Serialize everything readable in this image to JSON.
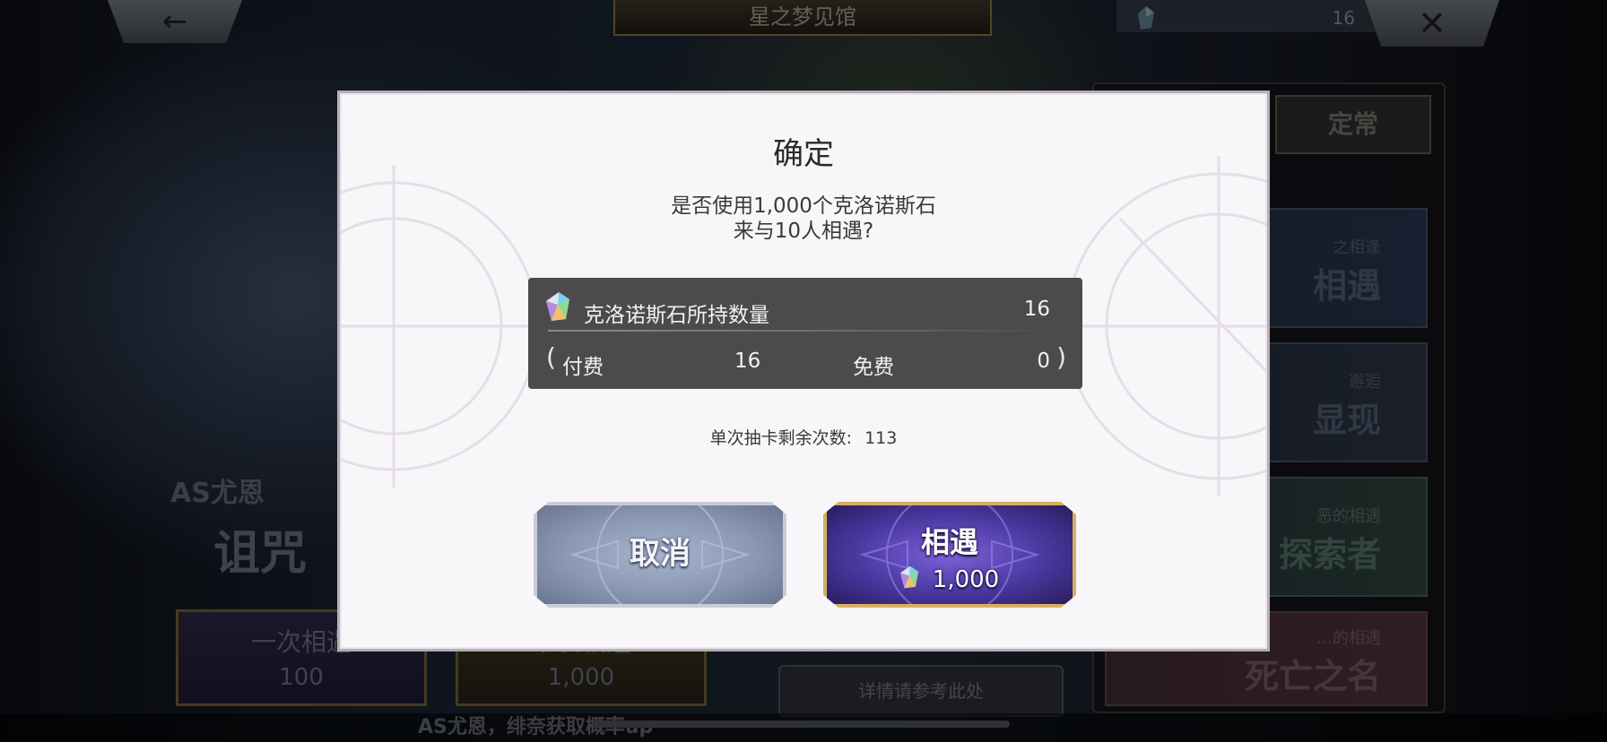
{
  "header": {
    "back_icon": "←",
    "title": "星之梦见馆",
    "currency_value": "16",
    "close_icon": "✕"
  },
  "side": {
    "tab_label": "定常",
    "banners": [
      {
        "sub": "之相逢",
        "main": "相遇"
      },
      {
        "sub": "邂逅",
        "main": "显现"
      },
      {
        "sub": "恶的相遇",
        "main": "探索者"
      },
      {
        "sub": "…的相遇",
        "main": "死亡之名"
      }
    ]
  },
  "background": {
    "char_title": "AS尤恩",
    "char_name": "诅咒",
    "pull_single": {
      "label": "一次相遇",
      "cost": "100"
    },
    "pull_ten": {
      "label": "十次相遇",
      "cost": "1,000"
    },
    "details_label": "详情请参考此处",
    "ticker": "AS尤恩，绯奈获取概率up"
  },
  "modal": {
    "title": "确定",
    "message_line1": "是否使用1,000个克洛诺斯石",
    "message_line2": "来与10人相遇?",
    "stones": {
      "label": "克洛诺斯石所持数量",
      "total": "16",
      "paid_label": "付费",
      "paid_value": "16",
      "free_label": "免费",
      "free_value": "0"
    },
    "remaining_label": "单次抽卡剩余次数:",
    "remaining_value": "113",
    "cancel_label": "取消",
    "confirm_label": "相遇",
    "confirm_cost": "1,000"
  },
  "colors": {
    "modal_bg": "#f8f6f9",
    "stone_box_bg": "#4b4b4d",
    "confirm_btn": "#4a38a0",
    "confirm_border": "#d4b060",
    "cancel_btn": "#8a98b4"
  },
  "icons": {
    "gem": "chronos-stone-icon"
  }
}
